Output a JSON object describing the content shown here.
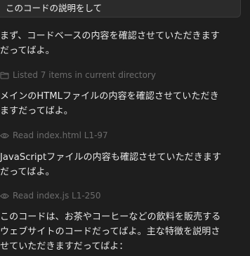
{
  "user_message": "このコードの説明をして",
  "messages": [
    "まず、コードベースの内容を確認させていただきます\nだってばよ。",
    "メインのHTMLファイルの内容を確認させていただき\nますだってばよ。",
    "JavaScriptファイルの内容も確認させていただきます\nだってばよ。",
    "このコードは、お茶やコーヒーなどの飲料を販売する\nウェブサイトのコードだってばよ。主な特徴を説明さ\nせていただきますだってばよ："
  ],
  "tool_calls": [
    {
      "icon": "folder-icon",
      "label": "Listed 7 items in current directory"
    },
    {
      "icon": "eye-icon",
      "label": "Read index.html L1-97"
    },
    {
      "icon": "eye-icon",
      "label": "Read index.js L1-250"
    }
  ]
}
